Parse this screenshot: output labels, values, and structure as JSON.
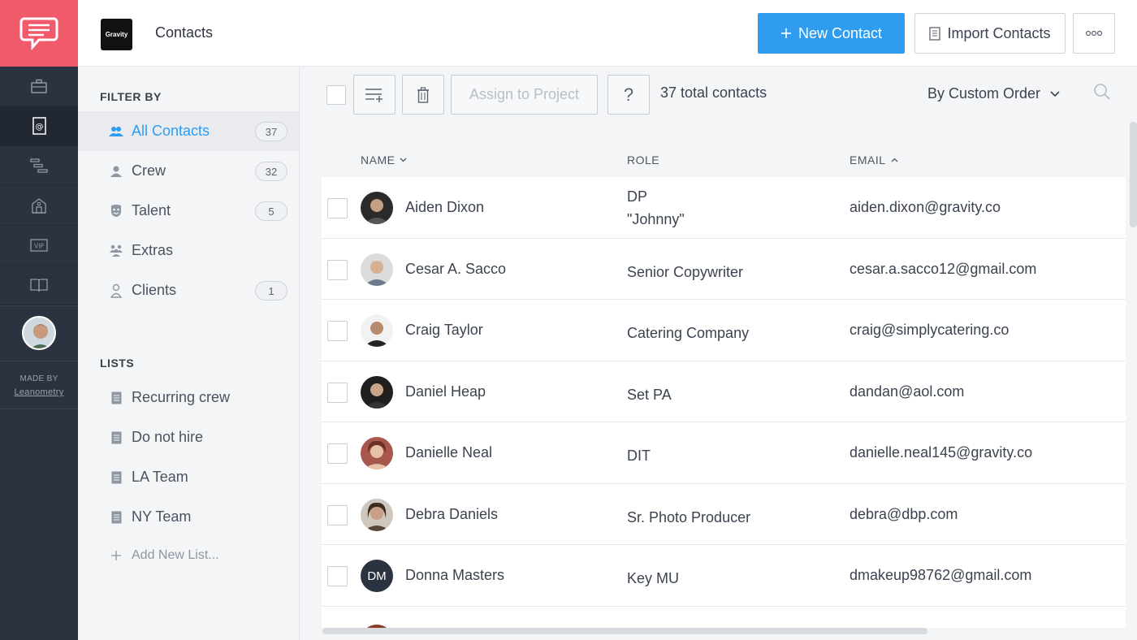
{
  "rail": {
    "made_by_label": "MADE BY",
    "made_by_link": "Leanometry"
  },
  "header": {
    "brand_logo_text": "Gravity",
    "title": "Contacts",
    "new_contact_label": "New Contact",
    "import_label": "Import Contacts"
  },
  "filters": {
    "section_title": "FILTER BY",
    "items": [
      {
        "label": "All Contacts",
        "count": "37"
      },
      {
        "label": "Crew",
        "count": "32"
      },
      {
        "label": "Talent",
        "count": "5"
      },
      {
        "label": "Extras",
        "count": ""
      },
      {
        "label": "Clients",
        "count": "1"
      }
    ]
  },
  "lists": {
    "section_title": "LISTS",
    "items": [
      {
        "label": "Recurring crew"
      },
      {
        "label": "Do not hire"
      },
      {
        "label": "LA Team"
      },
      {
        "label": "NY Team"
      }
    ],
    "add_label": "Add New List..."
  },
  "toolbar": {
    "assign_label": "Assign to Project",
    "help_label": "?",
    "total_label": "37 total contacts",
    "sort_label": "By Custom Order"
  },
  "table": {
    "headers": {
      "name": "NAME",
      "role": "ROLE",
      "email": "EMAIL"
    },
    "rows": [
      {
        "name": "Aiden Dixon",
        "role": "DP",
        "role2": "\"Johnny\"",
        "email": "aiden.dixon@gravity.co",
        "avatar_color": "#2b2b2b"
      },
      {
        "name": "Cesar A. Sacco",
        "role": "Senior Copywriter",
        "role2": "",
        "email": "cesar.a.sacco12@gmail.com",
        "avatar_color": "#b98a6a"
      },
      {
        "name": "Craig Taylor",
        "role": "Catering Company",
        "role2": "",
        "email": "craig@simplycatering.co",
        "avatar_color": "#8a6a55"
      },
      {
        "name": "Daniel Heap",
        "role": "Set PA",
        "role2": "",
        "email": "dandan@aol.com",
        "avatar_color": "#4a3a33"
      },
      {
        "name": "Danielle Neal",
        "role": "DIT",
        "role2": "",
        "email": "danielle.neal145@gravity.co",
        "avatar_color": "#a8574e"
      },
      {
        "name": "Debra Daniels",
        "role": "Sr. Photo Producer",
        "role2": "",
        "email": "debra@dbp.com",
        "avatar_color": "#5a4638"
      },
      {
        "name": "Donna Masters",
        "role": "Key MU",
        "role2": "",
        "email": "dmakeup98762@gmail.com",
        "avatar_initials": "DM"
      }
    ]
  },
  "colors": {
    "brand": "#f15a6b",
    "accent": "#2f9cf0",
    "rail": "#2c3340"
  }
}
